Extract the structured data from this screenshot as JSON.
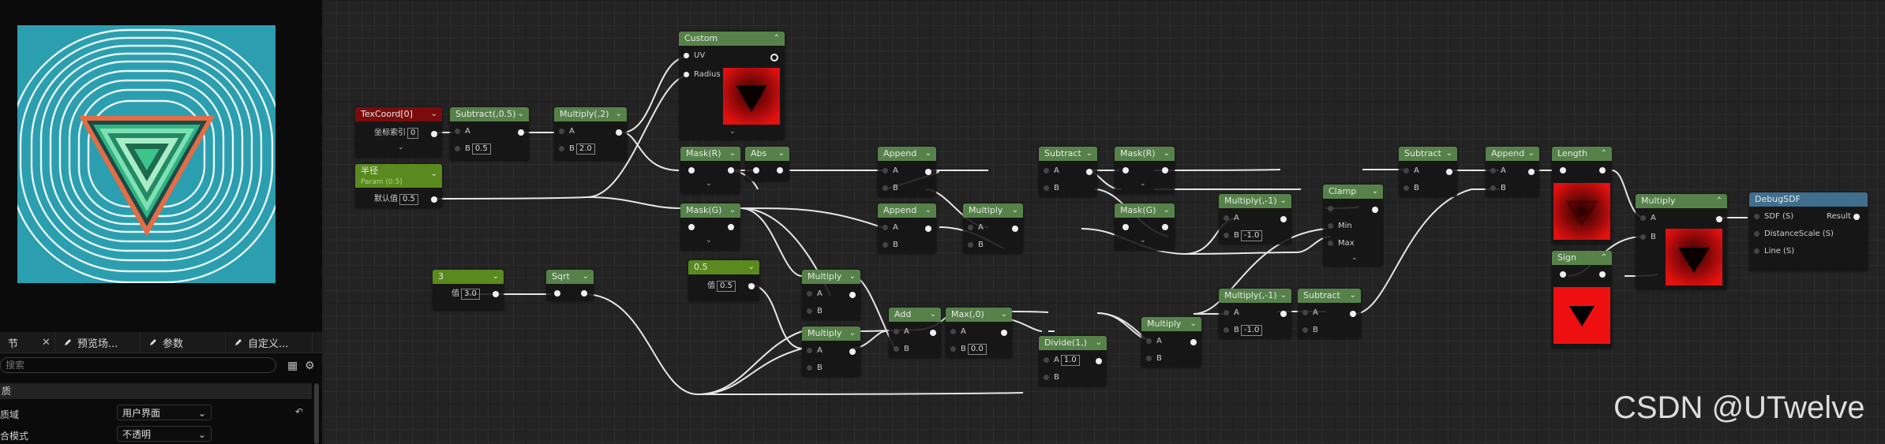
{
  "details": {
    "tabs": [
      {
        "label": "节",
        "icon": "close-icon"
      },
      {
        "label": "预览场...",
        "icon": "pencil-icon"
      },
      {
        "label": "参数",
        "icon": "pencil-icon"
      },
      {
        "label": "自定义...",
        "icon": "pencil-icon"
      }
    ],
    "search_placeholder": "搜索",
    "category": "质",
    "properties": [
      {
        "label": "质域",
        "value": "用户界面"
      },
      {
        "label": "合模式",
        "value": "不透明"
      }
    ]
  },
  "nodes": [
    {
      "id": "texcoord",
      "title": "TexCoord[0]",
      "header_color": "#7a0c0c",
      "pins": [
        {
          "label": "坐标索引",
          "value": "0"
        }
      ]
    },
    {
      "id": "radius-param",
      "title": "半径",
      "subtitle": "Param (0.5)",
      "header_color": "#5a8a1e",
      "pins": [
        {
          "label": "默认值",
          "value": "0.5"
        }
      ]
    },
    {
      "id": "subtract-05",
      "title": "Subtract(,0.5)",
      "header_color": "#56824a",
      "pins": [
        {
          "label": "A"
        },
        {
          "label": "B",
          "value": "0.5"
        }
      ]
    },
    {
      "id": "multiply-2",
      "title": "Multiply(,2)",
      "header_color": "#56824a",
      "pins": [
        {
          "label": "A"
        },
        {
          "label": "B",
          "value": "2.0"
        }
      ]
    },
    {
      "id": "custom",
      "title": "Custom",
      "header_color": "#56824a",
      "pins": [
        {
          "label": "UV"
        },
        {
          "label": "Radius"
        }
      ]
    },
    {
      "id": "const-3",
      "title": "3",
      "header_color": "#5a8a1e",
      "pins": [
        {
          "label": "值",
          "value": "3.0"
        }
      ]
    },
    {
      "id": "sqrt",
      "title": "Sqrt",
      "header_color": "#56824a",
      "pins": []
    },
    {
      "id": "mask-r-1",
      "title": "Mask(R)",
      "header_color": "#56824a",
      "pins": []
    },
    {
      "id": "abs",
      "title": "Abs",
      "header_color": "#56824a",
      "pins": []
    },
    {
      "id": "mask-g-1",
      "title": "Mask(G)",
      "header_color": "#56824a",
      "pins": []
    },
    {
      "id": "const-05",
      "title": "0.5",
      "header_color": "#5a8a1e",
      "pins": [
        {
          "label": "值",
          "value": "0.5"
        }
      ]
    },
    {
      "id": "multiply-a",
      "title": "Multiply",
      "header_color": "#56824a",
      "pins": [
        {
          "label": "A"
        },
        {
          "label": "B"
        }
      ]
    },
    {
      "id": "multiply-b",
      "title": "Multiply",
      "header_color": "#56824a",
      "pins": [
        {
          "label": "A"
        },
        {
          "label": "B"
        }
      ]
    },
    {
      "id": "append-1",
      "title": "Append",
      "header_color": "#56824a",
      "pins": [
        {
          "label": "A"
        },
        {
          "label": "B"
        }
      ]
    },
    {
      "id": "append-2",
      "title": "Append",
      "header_color": "#56824a",
      "pins": [
        {
          "label": "A"
        },
        {
          "label": "B"
        }
      ]
    },
    {
      "id": "multiply-c",
      "title": "Multiply",
      "header_color": "#56824a",
      "pins": [
        {
          "label": "A"
        },
        {
          "label": "B"
        }
      ]
    },
    {
      "id": "add",
      "title": "Add",
      "header_color": "#56824a",
      "pins": [
        {
          "label": "A"
        },
        {
          "label": "B"
        }
      ]
    },
    {
      "id": "max-0",
      "title": "Max(,0)",
      "header_color": "#56824a",
      "pins": [
        {
          "label": "A"
        },
        {
          "label": "B",
          "value": "0.0"
        }
      ]
    },
    {
      "id": "subtract-1",
      "title": "Subtract",
      "header_color": "#56824a",
      "pins": [
        {
          "label": "A"
        },
        {
          "label": "B"
        }
      ]
    },
    {
      "id": "mask-r-2",
      "title": "Mask(R)",
      "header_color": "#56824a",
      "pins": []
    },
    {
      "id": "mask-g-2",
      "title": "Mask(G)",
      "header_color": "#56824a",
      "pins": []
    },
    {
      "id": "divide-1",
      "title": "Divide(1,)",
      "header_color": "#56824a",
      "pins": [
        {
          "label": "A",
          "value": "1.0"
        },
        {
          "label": "B"
        }
      ]
    },
    {
      "id": "multiply-d",
      "title": "Multiply",
      "header_color": "#56824a",
      "pins": [
        {
          "label": "A"
        },
        {
          "label": "B"
        }
      ]
    },
    {
      "id": "multiply-neg1-a",
      "title": "Multiply(,-1)",
      "header_color": "#56824a",
      "pins": [
        {
          "label": "A"
        },
        {
          "label": "B",
          "value": "-1.0"
        }
      ]
    },
    {
      "id": "clamp",
      "title": "Clamp",
      "header_color": "#56824a",
      "pins": [
        {
          "label": ""
        },
        {
          "label": "Min"
        },
        {
          "label": "Max"
        }
      ]
    },
    {
      "id": "multiply-neg1-b",
      "title": "Multiply(,-1)",
      "header_color": "#56824a",
      "pins": [
        {
          "label": "A"
        },
        {
          "label": "B",
          "value": "-1.0"
        }
      ]
    },
    {
      "id": "subtract-2",
      "title": "Subtract",
      "header_color": "#56824a",
      "pins": [
        {
          "label": "A"
        },
        {
          "label": "B"
        }
      ]
    },
    {
      "id": "subtract-3",
      "title": "Subtract",
      "header_color": "#56824a",
      "pins": [
        {
          "label": "A"
        },
        {
          "label": "B"
        }
      ]
    },
    {
      "id": "append-3",
      "title": "Append",
      "header_color": "#56824a",
      "pins": [
        {
          "label": "A"
        },
        {
          "label": "B"
        }
      ]
    },
    {
      "id": "length",
      "title": "Length",
      "header_color": "#56824a",
      "pins": []
    },
    {
      "id": "sign",
      "title": "Sign",
      "header_color": "#56824a",
      "pins": []
    },
    {
      "id": "multiply-e",
      "title": "Multiply",
      "header_color": "#56824a",
      "pins": [
        {
          "label": "A"
        },
        {
          "label": "B"
        }
      ]
    },
    {
      "id": "debug-sdf",
      "title": "DebugSDF",
      "header_color": "#3f6e8e",
      "pins": [
        {
          "label": "SDF (S)"
        },
        {
          "label": "DistanceScale (S)"
        },
        {
          "label": "Line (S)"
        }
      ],
      "output": "Result"
    }
  ],
  "watermark": "CSDN @UTwelve"
}
